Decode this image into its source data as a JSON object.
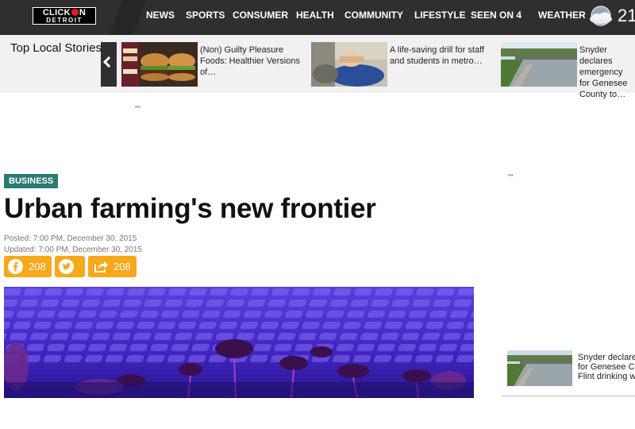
{
  "header": {
    "logo": {
      "line1": "CLICK ON",
      "line1_left": "CLICK",
      "line1_right": "N",
      "line2": "DETROIT"
    },
    "nav": [
      "NEWS",
      "SPORTS",
      "CONSUMER",
      "HEALTH",
      "COMMUNITY",
      "LIFESTYLE",
      "SEEN ON 4",
      "WEATHER"
    ],
    "temperature": "21",
    "weather_icon": "cloud-moon-icon"
  },
  "top_stories": {
    "title": "Top Local Stories",
    "items": [
      {
        "text": "(Non) Guilty Pleasure Foods: Healthier Versions of…",
        "image": "burgers-photo"
      },
      {
        "text": "A life-saving drill for staff and students in metro…",
        "image": "cpr-drill-photo"
      },
      {
        "text": "Snyder declares emergency for Genesee County to…",
        "image": "river-dam-photo"
      }
    ]
  },
  "ads": {
    "top_placeholder": "\"\"",
    "side_placeholder": "\"\""
  },
  "article": {
    "category": "BUSINESS",
    "headline": "Urban farming's new frontier",
    "posted": "Posted: 7:00 PM, December 30, 2015",
    "updated": "Updated: 7:00 PM, December 30, 2015",
    "share": {
      "facebook_count": "208",
      "total_count": "208"
    },
    "hero_image": "microgreens-under-purple-light"
  },
  "sidebar": {
    "story_text": [
      "Snyder declares",
      "for Genesee Co",
      "Flint drinking w"
    ]
  },
  "colors": {
    "header_bg": "#2f2f2f",
    "stories_bg": "#f1f1f1",
    "business_tag": "#2b7a74",
    "share_button": "#f7a81b"
  }
}
